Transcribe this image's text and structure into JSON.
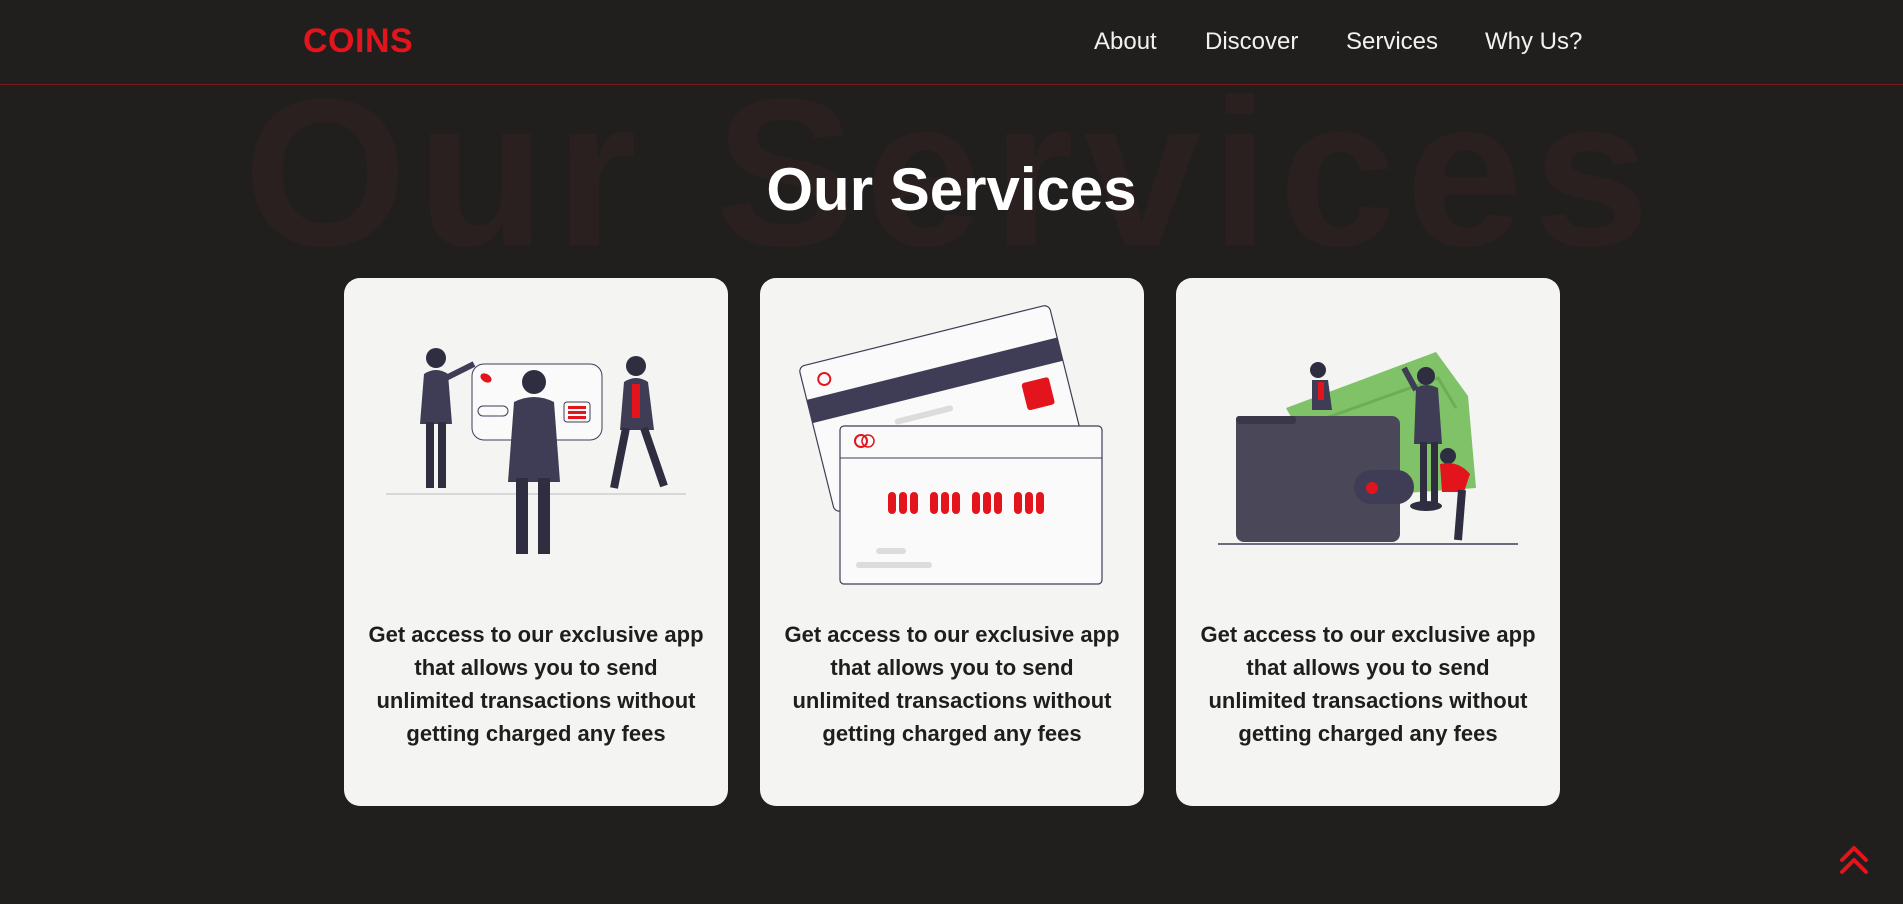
{
  "brand": {
    "logo_text": "COINS",
    "accent_color": "#e3141c",
    "background": "#201f1e"
  },
  "nav": {
    "items": [
      {
        "label": "About"
      },
      {
        "label": "Discover"
      },
      {
        "label": "Services"
      },
      {
        "label": "Why Us?"
      }
    ]
  },
  "hero": {
    "title": "Our Services",
    "background_watermark": "Our Services"
  },
  "cards": [
    {
      "illustration": "team-with-credit-card-illustration",
      "text": "Get access to our exclusive app that allows you to send unlimited transactions without getting charged any fees"
    },
    {
      "illustration": "two-credit-cards-illustration",
      "text": "Get access to our exclusive app that allows you to send unlimited transactions without getting charged any fees"
    },
    {
      "illustration": "wallet-with-money-illustration",
      "text": "Get access to our exclusive app that allows you to send unlimited transactions without getting charged any fees"
    }
  ],
  "scroll_top": {
    "icon": "double-chevron-up-icon"
  }
}
